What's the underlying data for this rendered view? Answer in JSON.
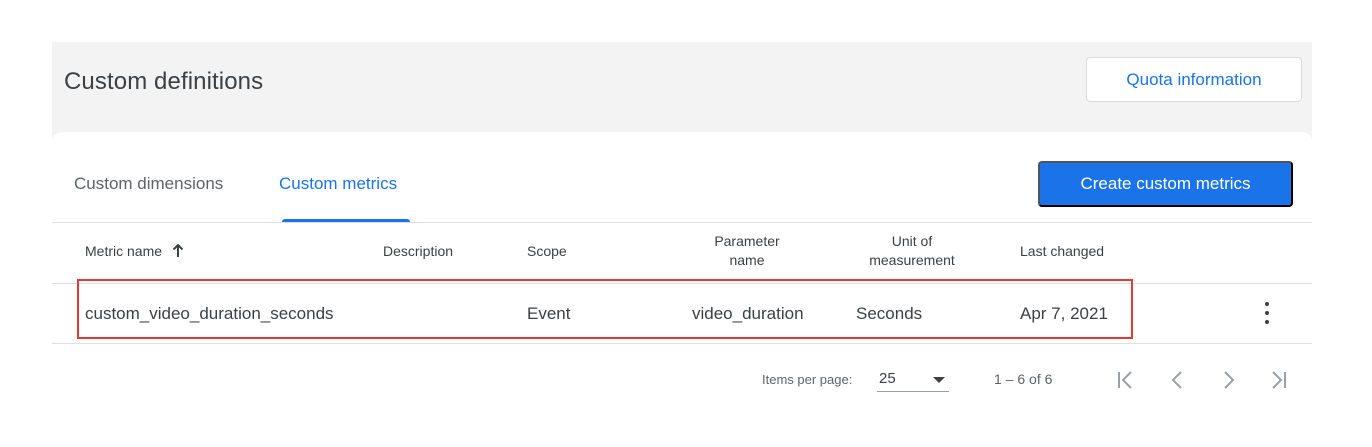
{
  "header": {
    "title": "Custom definitions",
    "quota_label": "Quota information"
  },
  "tabs": [
    {
      "label": "Custom dimensions",
      "active": false
    },
    {
      "label": "Custom metrics",
      "active": true
    }
  ],
  "actions": {
    "create_label": "Create custom metrics"
  },
  "table": {
    "columns": {
      "metric_name": "Metric name",
      "description": "Description",
      "scope": "Scope",
      "parameter_name": [
        "Parameter",
        "name"
      ],
      "unit": [
        "Unit of",
        "measurement"
      ],
      "last_changed": "Last changed"
    },
    "rows": [
      {
        "metric_name": "custom_video_duration_seconds",
        "description": "",
        "scope": "Event",
        "parameter_name": "video_duration",
        "unit": "Seconds",
        "last_changed": "Apr 7, 2021"
      }
    ]
  },
  "pagination": {
    "items_per_page_label": "Items per page:",
    "items_per_page_value": "25",
    "range": "1 – 6 of 6"
  },
  "colors": {
    "accent": "#1a73e8",
    "highlight": "#e53935",
    "background": "#f3f3f3"
  }
}
